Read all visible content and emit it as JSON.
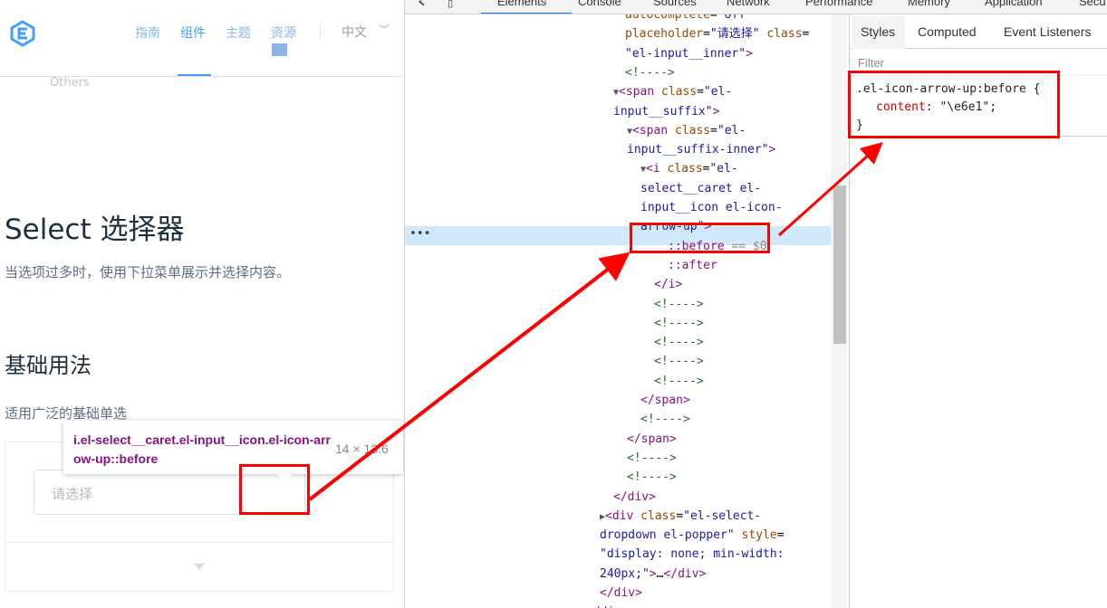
{
  "header": {
    "nav": [
      "指南",
      "组件",
      "主题",
      "资源"
    ],
    "active_nav_index": 1,
    "language": "中文",
    "others": "Others"
  },
  "content": {
    "title": "Select 选择器",
    "description": "当选项过多时，使用下拉菜单展示并选择内容。",
    "section_title": "基础用法",
    "section_desc": "适用广泛的基础单选",
    "select_placeholder": "请选择"
  },
  "tooltip": {
    "selector": "i.el-select__caret.el-input__icon.el-icon-arrow-up::before",
    "size": "14 × 13.6"
  },
  "devtools": {
    "tabs": [
      "Elements",
      "Console",
      "Sources",
      "Network",
      "Performance",
      "Memory",
      "Application",
      "Secu"
    ],
    "active_tab": "Elements",
    "styles_tabs": [
      "Styles",
      "Computed",
      "Event Listeners"
    ],
    "filter_placeholder": "Filter",
    "rule": {
      "selector": ".el-icon-arrow-up:before {",
      "property": "content",
      "value": "\"\\e6e1\";",
      "close": "}"
    },
    "dom_lines": [
      {
        "indent": 690,
        "html": "<span class=\"attr\">autocomplete</span>=<span class=\"val\">\"off\"</span>"
      },
      {
        "indent": 690,
        "html": "<span class=\"attr\">placeholder</span>=<span class=\"val\">\"请选择\"</span> <span class=\"attr\">class</span>="
      },
      {
        "indent": 690,
        "html": "<span class=\"val\">\"el-input__inner\"</span><span class=\"tag\">&gt;</span>"
      },
      {
        "indent": 690,
        "html": "<span class=\"cmt\">&lt;!----&gt;</span>"
      },
      {
        "indent": 677,
        "html": "<span class=\"tri\">▼</span><span class=\"tag\">&lt;span</span> <span class=\"attr\">class</span>=<span class=\"val\">\"el-</span>"
      },
      {
        "indent": 677,
        "html": "<span class=\"val\">input__suffix\"</span><span class=\"tag\">&gt;</span>"
      },
      {
        "indent": 692,
        "html": "<span class=\"tri\">▼</span><span class=\"tag\">&lt;span</span> <span class=\"attr\">class</span>=<span class=\"val\">\"el-</span>"
      },
      {
        "indent": 692,
        "html": "<span class=\"val\">input__suffix-inner\"</span><span class=\"tag\">&gt;</span>"
      },
      {
        "indent": 707,
        "html": "<span class=\"tri\">▼</span><span class=\"tag\">&lt;i</span> <span class=\"attr\">class</span>=<span class=\"val\">\"el-</span>"
      },
      {
        "indent": 707,
        "html": "<span class=\"val\">select__caret el-</span>"
      },
      {
        "indent": 707,
        "html": "<span class=\"val\">input__icon el-icon-</span>"
      },
      {
        "indent": 707,
        "html": "<span class=\"val\">arrow-up\"</span><span class=\"tag\">&gt;</span>"
      },
      {
        "indent": 737,
        "html": "<span class=\"pseudo\">::before</span> <span style=\"color:#888\">== $0</span>"
      },
      {
        "indent": 737,
        "html": "<span class=\"pseudo\">::after</span>"
      },
      {
        "indent": 722,
        "html": "<span class=\"tag\">&lt;/i&gt;</span>"
      },
      {
        "indent": 722,
        "html": "<span class=\"cmt\">&lt;!----&gt;</span>"
      },
      {
        "indent": 722,
        "html": "<span class=\"cmt\">&lt;!----&gt;</span>"
      },
      {
        "indent": 722,
        "html": "<span class=\"cmt\">&lt;!----&gt;</span>"
      },
      {
        "indent": 722,
        "html": "<span class=\"cmt\">&lt;!----&gt;</span>"
      },
      {
        "indent": 722,
        "html": "<span class=\"cmt\">&lt;!----&gt;</span>"
      },
      {
        "indent": 707,
        "html": "<span class=\"tag\">&lt;/span&gt;</span>"
      },
      {
        "indent": 707,
        "html": "<span class=\"cmt\">&lt;!----&gt;</span>"
      },
      {
        "indent": 692,
        "html": "<span class=\"tag\">&lt;/span&gt;</span>"
      },
      {
        "indent": 692,
        "html": "<span class=\"cmt\">&lt;!----&gt;</span>"
      },
      {
        "indent": 692,
        "html": "<span class=\"cmt\">&lt;!----&gt;</span>"
      },
      {
        "indent": 677,
        "html": "<span class=\"tag\">&lt;/div&gt;</span>"
      },
      {
        "indent": 662,
        "html": "<span class=\"tri\">▶</span><span class=\"tag\">&lt;div</span> <span class=\"attr\">class</span>=<span class=\"val\">\"el-select-</span>"
      },
      {
        "indent": 662,
        "html": "<span class=\"val\">dropdown el-popper\"</span> <span class=\"attr\">style</span>="
      },
      {
        "indent": 662,
        "html": "<span class=\"val\">\"display: none; min-width:</span>"
      },
      {
        "indent": 662,
        "html": "<span class=\"val\">240px;\"</span><span class=\"tag\">&gt;</span>…<span class=\"tag\">&lt;/div&gt;</span>"
      },
      {
        "indent": 662,
        "html": "<span class=\"tag\">&lt;/div&gt;</span>"
      },
      {
        "indent": 647,
        "html": "<span class=\"tag\">&lt;/div&gt;</span>"
      }
    ]
  }
}
